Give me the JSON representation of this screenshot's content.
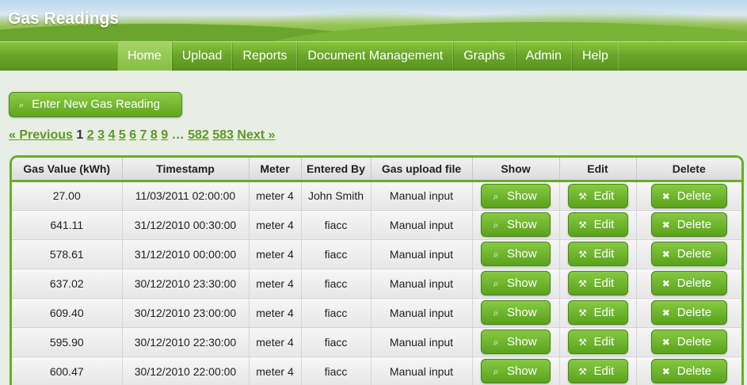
{
  "app": {
    "title": "Gas Readings"
  },
  "nav": [
    "Home",
    "Upload",
    "Reports",
    "Document Management",
    "Graphs",
    "Admin",
    "Help"
  ],
  "actions": {
    "new_reading": "Enter New Gas Reading"
  },
  "pagination": {
    "previous": "« Previous",
    "current": "1",
    "pages": [
      "2",
      "3",
      "4",
      "5",
      "6",
      "7",
      "8",
      "9"
    ],
    "ellipsis": "…",
    "last_pages": [
      "582",
      "583"
    ],
    "next": "Next »"
  },
  "table": {
    "columns": [
      "Gas Value (kWh)",
      "Timestamp",
      "Meter",
      "Entered By",
      "Gas upload file",
      "Show",
      "Edit",
      "Delete"
    ],
    "button_labels": {
      "show": "Show",
      "edit": "Edit",
      "delete": "Delete"
    },
    "rows": [
      {
        "value": "27.00",
        "timestamp": "11/03/2011 02:00:00",
        "meter": "meter 4",
        "entered_by": "John Smith",
        "upload_file": "Manual input"
      },
      {
        "value": "641.11",
        "timestamp": "31/12/2010 00:30:00",
        "meter": "meter 4",
        "entered_by": "fiacc",
        "upload_file": "Manual input"
      },
      {
        "value": "578.61",
        "timestamp": "31/12/2010 00:00:00",
        "meter": "meter 4",
        "entered_by": "fiacc",
        "upload_file": "Manual input"
      },
      {
        "value": "637.02",
        "timestamp": "30/12/2010 23:30:00",
        "meter": "meter 4",
        "entered_by": "fiacc",
        "upload_file": "Manual input"
      },
      {
        "value": "609.40",
        "timestamp": "30/12/2010 23:00:00",
        "meter": "meter 4",
        "entered_by": "fiacc",
        "upload_file": "Manual input"
      },
      {
        "value": "595.90",
        "timestamp": "30/12/2010 22:30:00",
        "meter": "meter 4",
        "entered_by": "fiacc",
        "upload_file": "Manual input"
      },
      {
        "value": "600.47",
        "timestamp": "30/12/2010 22:00:00",
        "meter": "meter 4",
        "entered_by": "fiacc",
        "upload_file": "Manual input"
      }
    ]
  },
  "colors": {
    "accent": "#6aab2c",
    "button": "#5aa21d",
    "link": "#5e9a23"
  },
  "icons": {
    "show": "search-icon",
    "edit": "wrench-icon",
    "delete": "close-icon",
    "new": "search-icon"
  }
}
